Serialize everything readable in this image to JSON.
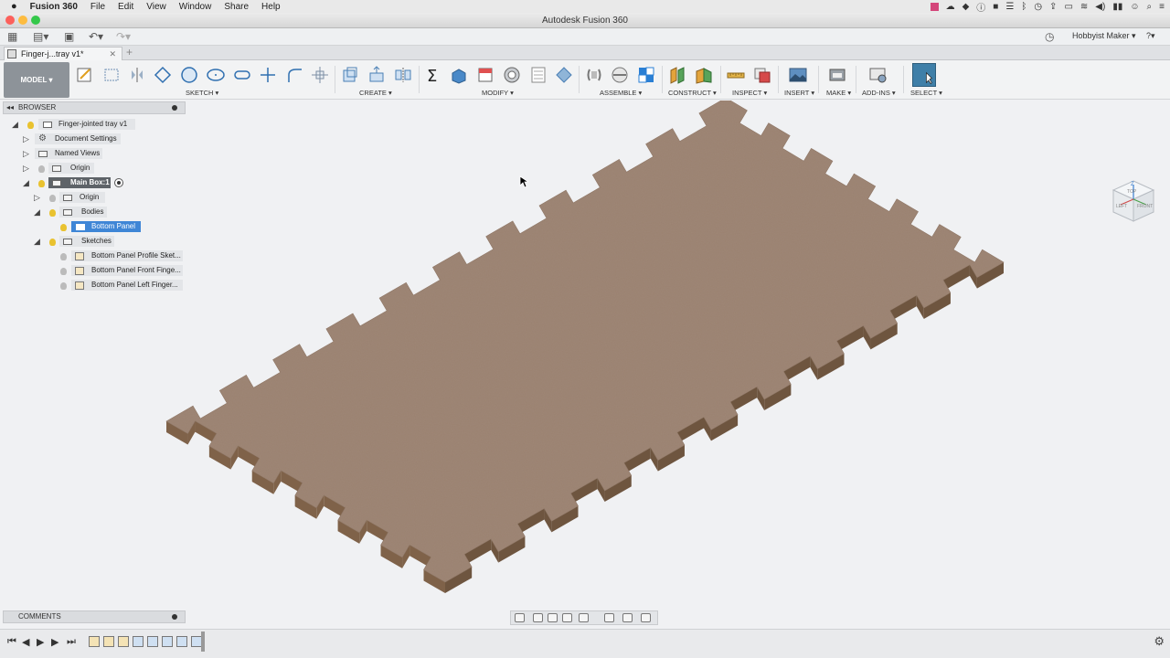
{
  "menubar": {
    "apple": "",
    "app": "Fusion 360",
    "items": [
      "File",
      "Edit",
      "View",
      "Window",
      "Share",
      "Help"
    ]
  },
  "window": {
    "title": "Autodesk Fusion 360"
  },
  "qat": {
    "account": "Hobbyist Maker ▾",
    "help": "?▾"
  },
  "tab": {
    "title": "Finger-j...tray v1*",
    "add": "+"
  },
  "ribbon": {
    "workspace": "MODEL ▾",
    "groups": [
      "SKETCH ▾",
      "CREATE ▾",
      "MODIFY ▾",
      "ASSEMBLE ▾",
      "CONSTRUCT ▾",
      "INSPECT ▾",
      "INSERT ▾",
      "MAKE ▾",
      "ADD-INS ▾",
      "SELECT ▾"
    ]
  },
  "browser": {
    "header": "BROWSER",
    "nodes": [
      {
        "label": "Finger-jointed tray v1"
      },
      {
        "label": "Document Settings"
      },
      {
        "label": "Named Views"
      },
      {
        "label": "Origin"
      },
      {
        "label": "Main Box:1"
      },
      {
        "label": "Origin"
      },
      {
        "label": "Bodies"
      },
      {
        "label": "Bottom Panel"
      },
      {
        "label": "Sketches"
      },
      {
        "label": "Bottom Panel Profile Sket..."
      },
      {
        "label": "Bottom Panel Front Finge..."
      },
      {
        "label": "Bottom Panel Left Finger..."
      }
    ]
  },
  "viewcube": {
    "top": "TOP",
    "left": "LEFT",
    "front": "FRONT",
    "axis_z": "Z"
  },
  "comments": {
    "header": "COMMENTS"
  },
  "colors": {
    "accent": "#3f86d6",
    "wood_top": "#9a8170",
    "wood_edge": "#7a5e45"
  }
}
